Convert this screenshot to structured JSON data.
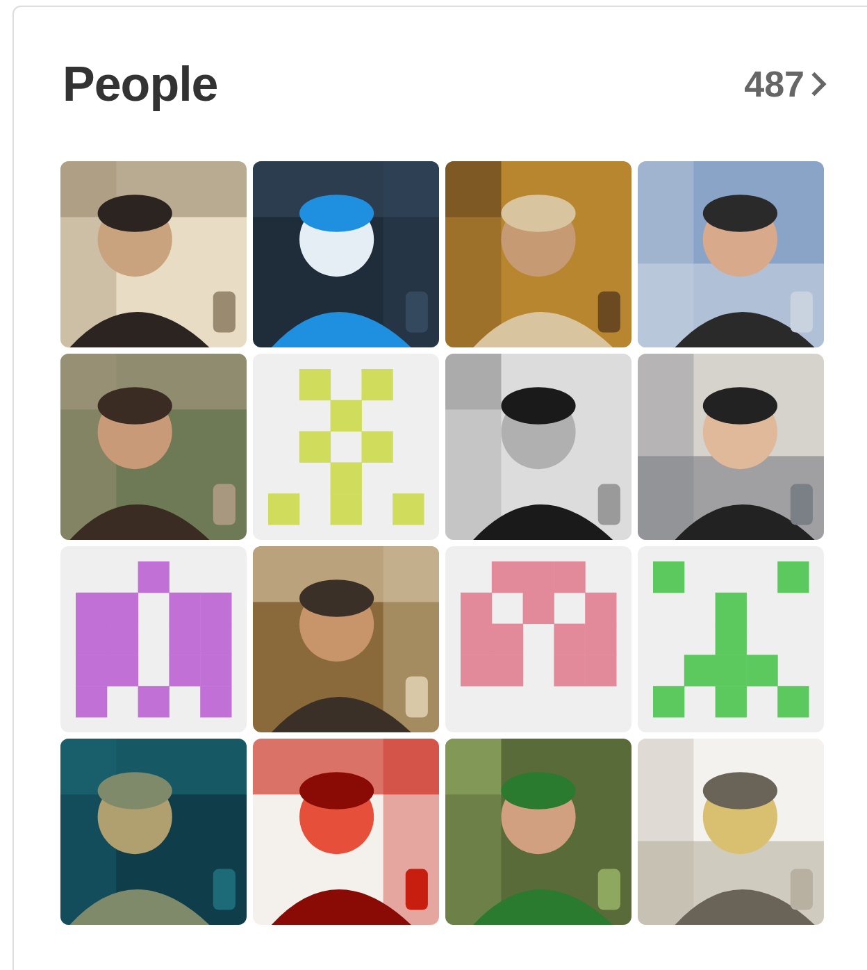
{
  "card": {
    "title": "People",
    "count": "487"
  },
  "avatars": [
    {
      "kind": "picture"
    },
    {
      "kind": "picture"
    },
    {
      "kind": "picture"
    },
    {
      "kind": "picture"
    },
    {
      "kind": "picture"
    },
    {
      "kind": "identicon",
      "color": "#d0dc5c"
    },
    {
      "kind": "picture"
    },
    {
      "kind": "picture"
    },
    {
      "kind": "identicon",
      "color": "#c170d6"
    },
    {
      "kind": "picture"
    },
    {
      "kind": "identicon",
      "color": "#e38a9a"
    },
    {
      "kind": "identicon",
      "color": "#5cc95f"
    },
    {
      "kind": "picture"
    },
    {
      "kind": "picture"
    },
    {
      "kind": "picture"
    },
    {
      "kind": "picture"
    }
  ]
}
